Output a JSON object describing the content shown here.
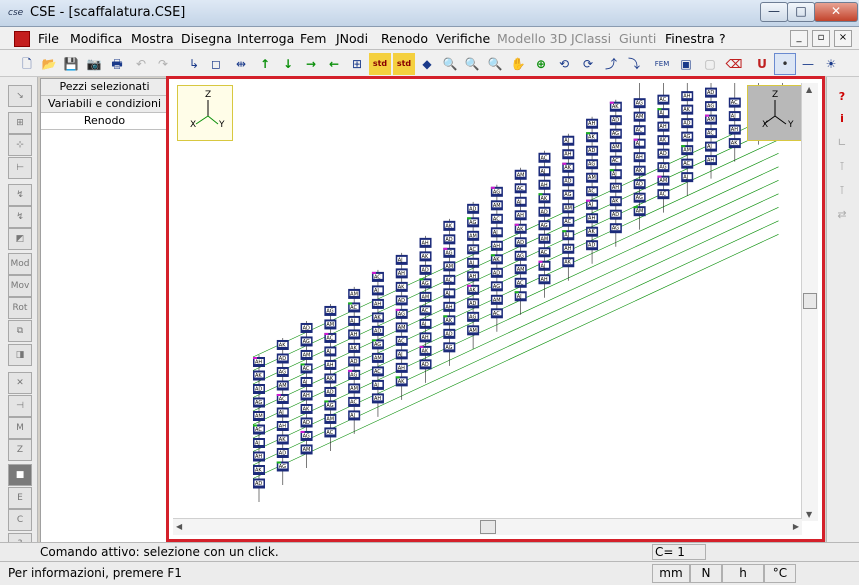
{
  "window": {
    "app_icon_text": "cse",
    "title": "CSE - [scaffalatura.CSE]",
    "minimize_symbol": "—",
    "maximize_symbol": "□",
    "close_symbol": "✕"
  },
  "menu": {
    "items": [
      {
        "label": "File",
        "enabled": true
      },
      {
        "label": "Modifica",
        "enabled": true
      },
      {
        "label": "Mostra",
        "enabled": true
      },
      {
        "label": "Disegna",
        "enabled": true
      },
      {
        "label": "Interroga",
        "enabled": true
      },
      {
        "label": "Fem",
        "enabled": true
      },
      {
        "label": "JNodi",
        "enabled": true
      },
      {
        "label": "Renodo",
        "enabled": true
      },
      {
        "label": "Verifiche",
        "enabled": true
      },
      {
        "label": "Modello 3D",
        "enabled": false
      },
      {
        "label": "JClassi",
        "enabled": false
      },
      {
        "label": "Giunti",
        "enabled": false
      },
      {
        "label": "Finestra",
        "enabled": true
      },
      {
        "label": "?",
        "enabled": true
      }
    ],
    "mdi_minimize": "_",
    "mdi_restore": "▫",
    "mdi_close": "×"
  },
  "toolbar": {
    "buttons": [
      {
        "name": "new-file-icon",
        "glyph": "🗋"
      },
      {
        "name": "open-folder-icon",
        "glyph": "📂"
      },
      {
        "name": "save-icon",
        "glyph": "💾"
      },
      {
        "name": "camera-icon",
        "glyph": "📷"
      },
      {
        "name": "print-icon",
        "glyph": "🖶"
      },
      {
        "name": "undo-icon",
        "glyph": "↶"
      },
      {
        "name": "redo-icon",
        "glyph": "↷"
      },
      {
        "name": "axis-icon",
        "glyph": "↳"
      },
      {
        "name": "frame-icon",
        "glyph": "◻"
      },
      {
        "name": "fit-width-icon",
        "glyph": "⇹"
      },
      {
        "name": "arrow-up-icon",
        "glyph": "↑"
      },
      {
        "name": "arrow-down-icon",
        "glyph": "↓"
      },
      {
        "name": "arrow-right-icon",
        "glyph": "→"
      },
      {
        "name": "arrow-left-icon",
        "glyph": "←"
      },
      {
        "name": "zoom-frame-icon",
        "glyph": "⊞"
      },
      {
        "name": "std-icon",
        "glyph": "std"
      },
      {
        "name": "std-alt-icon",
        "glyph": "std"
      },
      {
        "name": "tag-icon",
        "glyph": "◆"
      },
      {
        "name": "zoom-icon",
        "glyph": "🔍"
      },
      {
        "name": "zoom-in-icon",
        "glyph": "🔍"
      },
      {
        "name": "zoom-out-icon",
        "glyph": "🔍"
      },
      {
        "name": "pan-icon",
        "glyph": "✋"
      },
      {
        "name": "target-icon",
        "glyph": "⊕"
      },
      {
        "name": "rotate-left-icon",
        "glyph": "⟲"
      },
      {
        "name": "rotate-down-icon",
        "glyph": "⟳"
      },
      {
        "name": "rotate-up-icon",
        "glyph": "⤴"
      },
      {
        "name": "rotate-right-icon",
        "glyph": "⤵"
      },
      {
        "name": "fem-icon",
        "glyph": "FEM"
      },
      {
        "name": "view-mode-icon",
        "glyph": "▣"
      },
      {
        "name": "view-mode-alt-icon",
        "glyph": "▢"
      },
      {
        "name": "erase-icon",
        "glyph": "⌫"
      },
      {
        "name": "u-icon",
        "glyph": "U"
      },
      {
        "name": "dot-icon",
        "glyph": "•"
      },
      {
        "name": "line-icon",
        "glyph": "—"
      },
      {
        "name": "sun-icon",
        "glyph": "☀"
      }
    ]
  },
  "left_tools": [
    {
      "name": "tool-1-icon",
      "glyph": "↘"
    },
    {
      "name": "tool-2-icon",
      "glyph": "⊞"
    },
    {
      "name": "tool-3-icon",
      "glyph": "⊹"
    },
    {
      "name": "tool-4-icon",
      "glyph": "⊢"
    },
    {
      "name": "tool-5-icon",
      "glyph": "↯"
    },
    {
      "name": "tool-6-icon",
      "glyph": "↯"
    },
    {
      "name": "tool-7-icon",
      "glyph": "◩"
    },
    {
      "name": "mod-icon",
      "glyph": "Mod"
    },
    {
      "name": "mov-icon",
      "glyph": "Mov"
    },
    {
      "name": "rot-icon",
      "glyph": "Rot"
    },
    {
      "name": "tool-11-icon",
      "glyph": "⧉"
    },
    {
      "name": "tool-12-icon",
      "glyph": "◨"
    },
    {
      "name": "tool-13-icon",
      "glyph": "✕"
    },
    {
      "name": "tool-14-icon",
      "glyph": "⊣"
    },
    {
      "name": "tool-15-icon",
      "glyph": "M"
    },
    {
      "name": "tool-16-icon",
      "glyph": "Z"
    },
    {
      "name": "tool-17-icon",
      "glyph": "■"
    },
    {
      "name": "e-icon",
      "glyph": "E"
    },
    {
      "name": "c-icon",
      "glyph": "C"
    },
    {
      "name": "help-icon",
      "glyph": "?"
    }
  ],
  "panel": {
    "tabs": [
      "Pezzi selezionati",
      "Variabili e condizioni",
      "Renodo"
    ]
  },
  "canvas": {
    "axis_left": {
      "z": "Z",
      "x": "X",
      "y": "Y"
    },
    "axis_right": {
      "z": "Z",
      "x": "X",
      "y": "Y"
    },
    "node_labels": [
      "AH",
      "AK",
      "AD",
      "AG",
      "AM",
      "AC",
      "AJ"
    ]
  },
  "right_tools": [
    {
      "name": "question-icon",
      "glyph": "?"
    },
    {
      "name": "info-icon",
      "glyph": "i"
    },
    {
      "name": "rt-3-icon",
      "glyph": "∟"
    },
    {
      "name": "rt-4-icon",
      "glyph": "⊺"
    },
    {
      "name": "rt-5-icon",
      "glyph": "⊺"
    },
    {
      "name": "rt-6-icon",
      "glyph": "⇄"
    }
  ],
  "status": {
    "command": "Comando attivo: selezione con un click.",
    "counter": "C= 1",
    "help_text": "Per informazioni, premere F1",
    "units": [
      "mm",
      "N",
      "h",
      "°C"
    ]
  },
  "colors": {
    "highlight_border": "#d4202a",
    "node_fill": "#1b2a7a",
    "edge": "#0a8f0a"
  }
}
